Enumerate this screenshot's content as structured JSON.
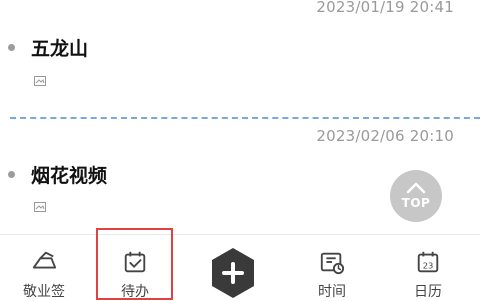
{
  "notes": [
    {
      "timestamp": "2023/01/19 20:41",
      "title": "五龙山"
    },
    {
      "timestamp": "2023/02/06 20:10",
      "title": "烟花视频"
    }
  ],
  "top_button": {
    "label": "TOP"
  },
  "bottom_nav": {
    "items": [
      {
        "label": "敬业签",
        "icon": "notebook-icon"
      },
      {
        "label": "待办",
        "icon": "calendar-check-icon"
      },
      {
        "label": "",
        "icon": "add-icon"
      },
      {
        "label": "时间",
        "icon": "calendar-clock-icon"
      },
      {
        "label": "日历",
        "icon": "calendar-day-icon",
        "day": "23"
      }
    ],
    "selected_index": 1
  },
  "colors": {
    "divider": "#7aa7de",
    "selection_border": "#e04141",
    "top_button_bg": "#c7c7c7",
    "add_button_bg": "#3a3a3a"
  }
}
